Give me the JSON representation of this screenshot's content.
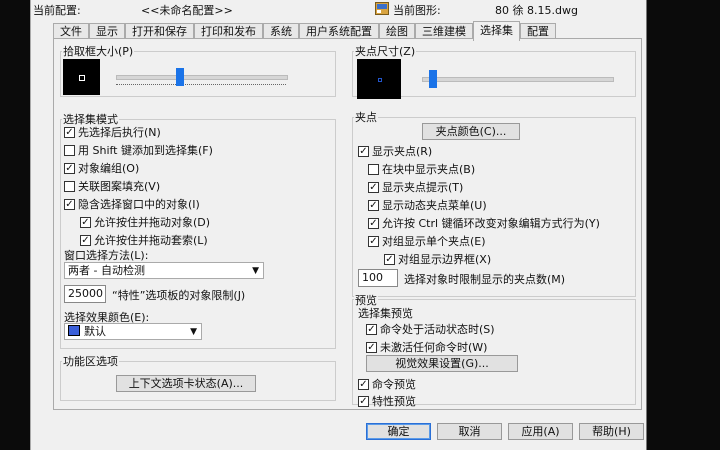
{
  "header": {
    "profile_label": "当前配置:",
    "profile_value": "<<未命名配置>>",
    "drawing_label": "当前图形:",
    "drawing_value": "80 徐  8.15.dwg"
  },
  "tabs": [
    {
      "label": "文件"
    },
    {
      "label": "显示"
    },
    {
      "label": "打开和保存"
    },
    {
      "label": "打印和发布"
    },
    {
      "label": "系统"
    },
    {
      "label": "用户系统配置"
    },
    {
      "label": "绘图"
    },
    {
      "label": "三维建模"
    },
    {
      "label": "选择集",
      "active": true
    },
    {
      "label": "配置"
    }
  ],
  "pickbox": {
    "title": "拾取框大小(P)",
    "level": 0.37
  },
  "grip_size": {
    "title": "夹点尺寸(Z)",
    "level": 0.05
  },
  "selection_modes": {
    "title": "选择集模式",
    "noun_verb": {
      "label": "先选择后执行(N)",
      "checked": true
    },
    "shift_add": {
      "label": "用 Shift 键添加到选择集(F)",
      "checked": false
    },
    "object_group": {
      "label": "对象编组(O)",
      "checked": true
    },
    "assoc_hatch": {
      "label": "关联图案填充(V)",
      "checked": false
    },
    "implied_window": {
      "label": "隐含选择窗口中的对象(I)",
      "checked": true
    },
    "press_drag_object": {
      "label": "允许按住并拖动对象(D)",
      "checked": true
    },
    "press_drag_lasso": {
      "label": "允许按住并拖动套索(L)",
      "checked": true
    },
    "window_method_label": "窗口选择方法(L):",
    "window_method_value": "两者 - 自动检测",
    "limit_value": "25000",
    "limit_label": "“特性”选项板的对象限制(J)",
    "effect_color_label": "选择效果颜色(E):",
    "effect_color_value": "默认",
    "effect_color_hex": "#3a5fd9"
  },
  "ribbon": {
    "title": "功能区选项",
    "ctx_button": "上下文选项卡状态(A)..."
  },
  "grips": {
    "title": "夹点",
    "color_button": "夹点颜色(C)...",
    "show_grips": {
      "label": "显示夹点(R)",
      "checked": true
    },
    "in_blocks": {
      "label": "在块中显示夹点(B)",
      "checked": false
    },
    "grip_tips": {
      "label": "显示夹点提示(T)",
      "checked": true
    },
    "dynamic_menu": {
      "label": "显示动态夹点菜单(U)",
      "checked": true
    },
    "ctrl_cycle": {
      "label": "允许按 Ctrl 键循环改变对象编辑方式行为(Y)",
      "checked": true
    },
    "single_group": {
      "label": "对组显示单个夹点(E)",
      "checked": true
    },
    "group_bbox": {
      "label": "对组显示边界框(X)",
      "checked": true
    },
    "limit_value": "100",
    "limit_label": "选择对象时限制显示的夹点数(M)"
  },
  "preview": {
    "title": "预览",
    "sub_title": "选择集预览",
    "active_cmd": {
      "label": "命令处于活动状态时(S)",
      "checked": true
    },
    "no_cmd": {
      "label": "未激活任何命令时(W)",
      "checked": true
    },
    "visual_button": "视觉效果设置(G)...",
    "cmd_preview": {
      "label": "命令预览",
      "checked": true
    },
    "prop_preview": {
      "label": "特性预览",
      "checked": true
    }
  },
  "buttons": {
    "ok": "确定",
    "cancel": "取消",
    "apply": "应用(A)",
    "help": "帮助(H)"
  }
}
